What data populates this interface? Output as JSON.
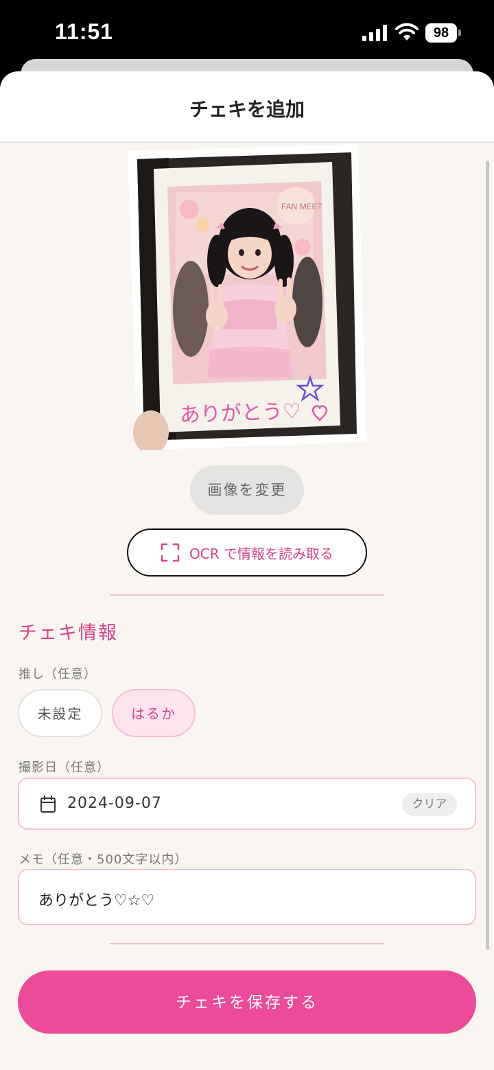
{
  "status_bar": {
    "time": "11:51",
    "battery": "98"
  },
  "sheet": {
    "title": "チェキを追加"
  },
  "photo": {
    "caption": "ありがとう♡"
  },
  "actions": {
    "change_image": "画像を変更",
    "ocr": "OCR で情報を読み取る"
  },
  "cheki_info": {
    "section_title": "チェキ情報",
    "oshi": {
      "label": "推し（任意）",
      "options": [
        "未設定",
        "はるか"
      ],
      "selected": "はるか"
    },
    "date": {
      "label": "撮影日（任意）",
      "value": "2024-09-07",
      "clear_label": "クリア"
    },
    "memo": {
      "label": "メモ（任意・500文字以内）",
      "value": "ありがとう♡☆♡"
    }
  },
  "save_button": "チェキを保存する",
  "colors": {
    "accent": "#d8418a",
    "save": "#ec4b98",
    "background": "#f9f6f1"
  }
}
